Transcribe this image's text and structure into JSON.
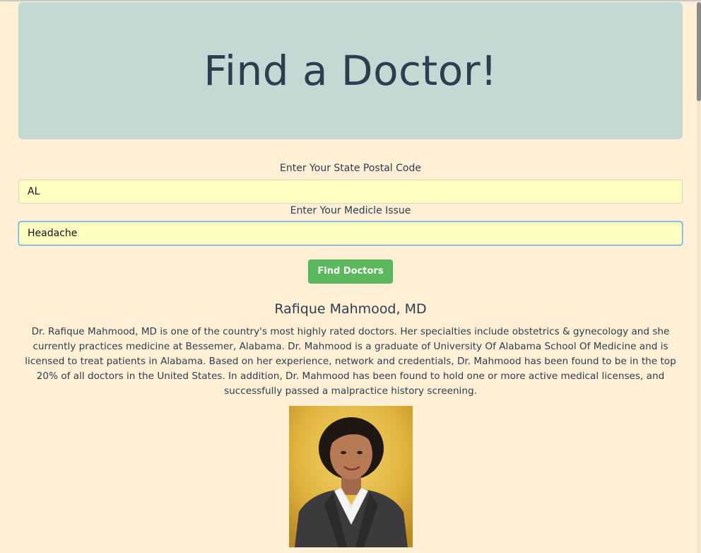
{
  "header": {
    "title": "Find a Doctor!"
  },
  "form": {
    "state_label": "Enter Your State Postal Code",
    "state_value": "AL",
    "issue_label": "Enter Your Medicle Issue",
    "issue_value": "Headache",
    "submit_label": "Find Doctors"
  },
  "result": {
    "name": "Rafique Mahmood, MD",
    "bio": "Dr. Rafique Mahmood, MD is one of the country's most highly rated doctors. Her specialties include obstetrics & gynecology and she currently practices medicine at Bessemer, Alabama. Dr. Mahmood is a graduate of University Of Alabama School Of Medicine and is licensed to treat patients in Alabama. Based on her experience, network and credentials, Dr. Mahmood has been found to be in the top 20% of all doctors in the United States. In addition, Dr. Mahmood has been found to hold one or more active medical licenses, and successfully passed a malpractice history screening."
  },
  "colors": {
    "background": "#feefd5",
    "jumbotron": "#c4d8d4",
    "input_bg": "#ffffc2",
    "button": "#5cb85c",
    "text": "#2c3e50"
  }
}
